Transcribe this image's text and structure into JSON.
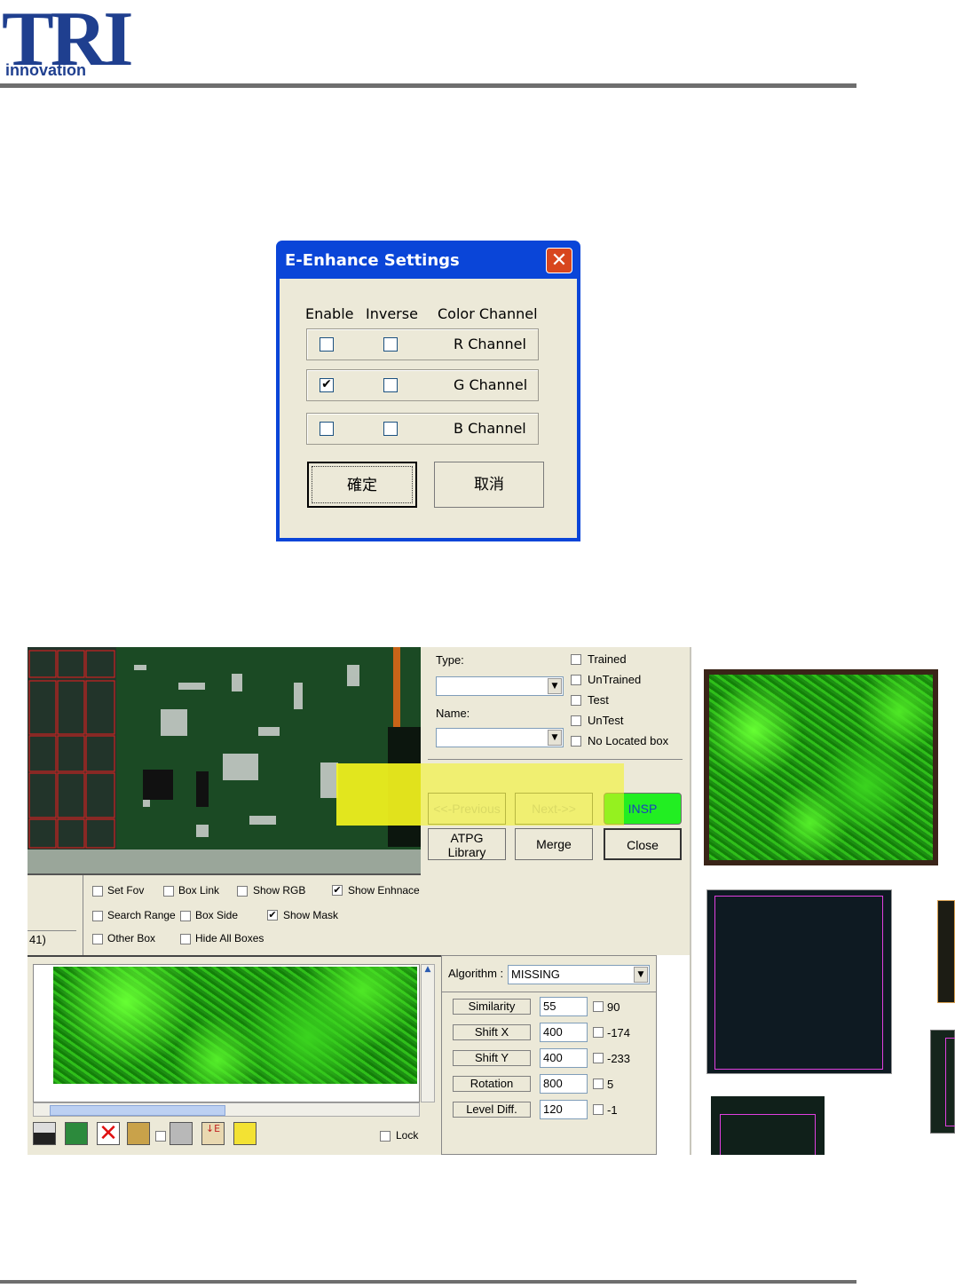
{
  "header": {
    "logo_main": "TRI",
    "logo_sub": "innovation"
  },
  "dialog": {
    "title": "E-Enhance Settings",
    "close_glyph": "✕",
    "columns": {
      "enable": "Enable",
      "inverse": "Inverse",
      "channel": "Color Channel"
    },
    "channels": [
      {
        "label": "R Channel",
        "enable": false,
        "inverse": false
      },
      {
        "label": "G Channel",
        "enable": true,
        "inverse": false
      },
      {
        "label": "B Channel",
        "enable": false,
        "inverse": false
      }
    ],
    "ok_label": "確定",
    "cancel_label": "取消"
  },
  "app": {
    "type_label": "Type:",
    "name_label": "Name:",
    "filters": [
      {
        "label": "Trained",
        "checked": false
      },
      {
        "label": "UnTrained",
        "checked": false
      },
      {
        "label": "Test",
        "checked": false
      },
      {
        "label": "UnTest",
        "checked": false
      },
      {
        "label": "No Located box",
        "checked": false
      }
    ],
    "prev_label": "<<-Previous",
    "next_label": "Next->>",
    "insp_label": "INSP",
    "atpg_label_1": "ATPG",
    "atpg_label_2": "Library",
    "merge_label": "Merge",
    "close_label": "Close",
    "options": [
      {
        "label": "Set Fov",
        "checked": false
      },
      {
        "label": "Box Link",
        "checked": false
      },
      {
        "label": "Show RGB",
        "checked": false
      },
      {
        "label": "Show Enhnace",
        "checked": true
      },
      {
        "label": "Search Range",
        "checked": false
      },
      {
        "label": "Box Side",
        "checked": false
      },
      {
        "label": "Show Mask",
        "checked": true
      },
      {
        "label": "Other Box",
        "checked": false
      },
      {
        "label": "Hide All Boxes",
        "checked": false
      }
    ],
    "left_fragment": "41)",
    "algorithm_label": "Algorithm :",
    "algorithm_value": "MISSING",
    "params": [
      {
        "label": "Similarity",
        "value": "55",
        "result": "90"
      },
      {
        "label": "Shift X",
        "value": "400",
        "result": "-174"
      },
      {
        "label": "Shift Y",
        "value": "400",
        "result": "-233"
      },
      {
        "label": "Rotation",
        "value": "800",
        "result": "5"
      },
      {
        "label": "Level Diff.",
        "value": "120",
        "result": "-1"
      }
    ],
    "lock_label": "Lock",
    "colors": {
      "insp": "#22ee22",
      "highlight": "#f4f41e",
      "arrow": "#ee1111",
      "pcb": "#1b4a24"
    }
  }
}
